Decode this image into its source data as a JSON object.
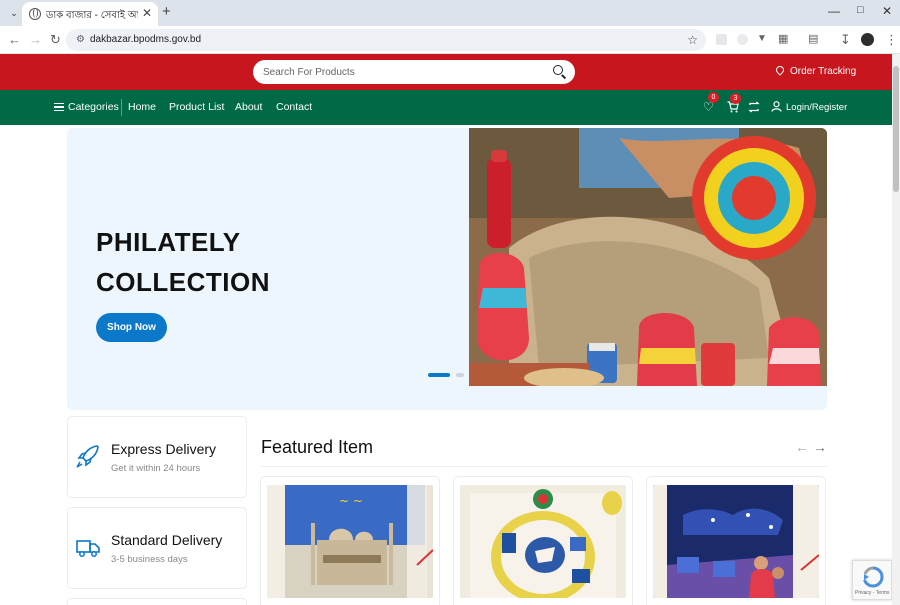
{
  "browser": {
    "tab_title": "ডাক বাজার - সেবাই আদর্শ",
    "url": "dakbazar.bpodms.gov.bd"
  },
  "header": {
    "search_placeholder": "Search For Products",
    "order_tracking": "Order Tracking"
  },
  "nav": {
    "categories": "Categories",
    "items": [
      "Home",
      "Product List",
      "About",
      "Contact"
    ],
    "wishlist_count": "0",
    "cart_count": "3",
    "login": "Login/Register"
  },
  "hero": {
    "title_line1": "PHILATELY",
    "title_line2": "COLLECTION",
    "button": "Shop Now",
    "slide_current": 1,
    "slide_total": 2
  },
  "features": [
    {
      "title": "Express Delivery",
      "subtitle": "Get it within 24 hours",
      "icon": "rocket-icon"
    },
    {
      "title": "Standard Delivery",
      "subtitle": "3-5 business days",
      "icon": "truck-icon"
    }
  ],
  "featured": {
    "heading": "Featured Item"
  },
  "colors": {
    "brand_red": "#c8161f",
    "brand_green": "#006a47",
    "accent_blue": "#0b78c9"
  }
}
